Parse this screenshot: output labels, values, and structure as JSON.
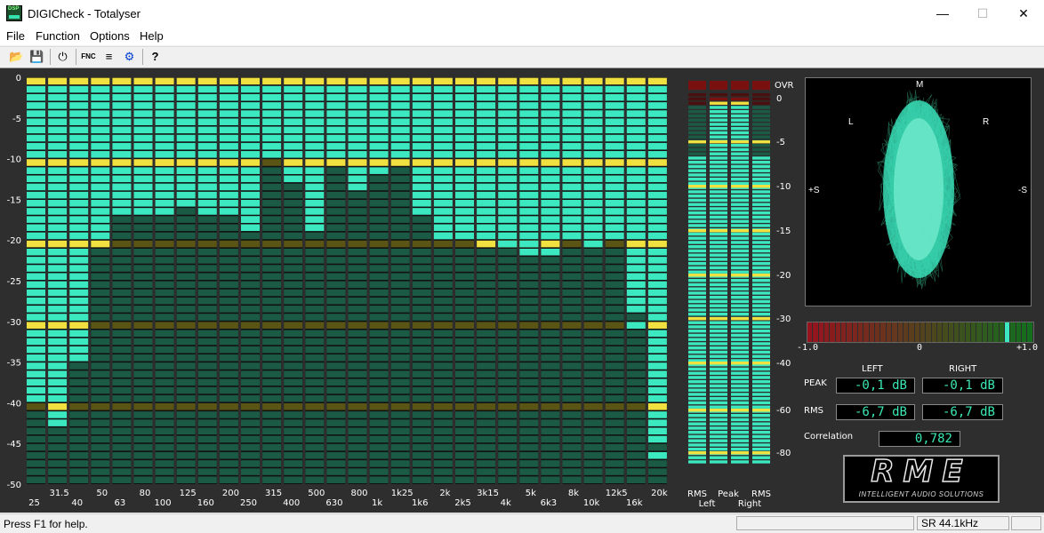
{
  "window": {
    "title": "DIGICheck - Totalyser",
    "icon_label": "DSP",
    "minimize_icon": "minimize-icon",
    "maximize_icon": "maximize-icon",
    "close_icon": "close-icon"
  },
  "menu": [
    "File",
    "Function",
    "Options",
    "Help"
  ],
  "toolbar": {
    "icons": [
      "open-folder-icon",
      "save-icon",
      "power-icon",
      "function-icon",
      "settings-icon",
      "gear-icon",
      "help-icon"
    ],
    "fnc_label": "FNC"
  },
  "colors": {
    "bar_fill": "#3ce8c0",
    "bar_empty": "#1b5a45",
    "marker_yellow": "#f0e040",
    "marker_dim": "#5a5514",
    "panel_bg": "#2e2e2e"
  },
  "chart_data": {
    "type": "bar",
    "title": "",
    "ylabel": "",
    "ylim": [
      -50,
      0
    ],
    "y_ticks": [
      "0",
      "-5",
      "-10",
      "-15",
      "-20",
      "-25",
      "-30",
      "-35",
      "-40",
      "-45",
      "-50"
    ],
    "categories": [
      "25",
      "31.5",
      "40",
      "50",
      "63",
      "80",
      "100",
      "125",
      "160",
      "200",
      "250",
      "315",
      "400",
      "500",
      "630",
      "800",
      "1k",
      "1k25",
      "1k6",
      "2k",
      "2k5",
      "3k15",
      "4k",
      "5k",
      "6k3",
      "8k",
      "10k",
      "12k5",
      "16k",
      "20k"
    ],
    "values": [
      -40.5,
      -43.5,
      -35.5,
      -21.5,
      -17.5,
      -17.5,
      -17.5,
      -16.5,
      -17.5,
      -17.5,
      -19.5,
      -10.5,
      -13.5,
      -19.5,
      -10.5,
      -14.5,
      -12.5,
      -11.5,
      -17.5,
      -20.5,
      -20.5,
      -21.5,
      -21.5,
      -22.5,
      -22.5,
      -20.5,
      -20.5,
      -20.5,
      -29.5,
      -45.5
    ],
    "peaks": [
      null,
      -34,
      -29,
      -18,
      -13,
      -12,
      -10,
      -11,
      -13,
      -9,
      -17,
      -6,
      -11,
      -18,
      -10,
      null,
      null,
      null,
      null,
      -19,
      -14,
      -17,
      -20,
      -20,
      -19,
      -19,
      -20,
      null,
      -30,
      -46
    ]
  },
  "level_meters": {
    "ovr_label": "OVR",
    "scale": [
      "0",
      "-5",
      "-10",
      "-15",
      "-20",
      "-30",
      "-40",
      "-60",
      "-80"
    ],
    "channels": [
      {
        "label_top": "RMS",
        "level": -6.7
      },
      {
        "label_top": "Peak",
        "level": -0.1
      },
      {
        "label_top": "Peak",
        "level": -0.1
      },
      {
        "label_top": "RMS",
        "level": -6.7
      }
    ],
    "label_row1": [
      "RMS",
      "Peak",
      "RMS"
    ],
    "label_row2": [
      "Left",
      "Right"
    ]
  },
  "goniometer": {
    "labels": {
      "m": "M",
      "l": "L",
      "r": "R",
      "plus_s": "+S",
      "minus_s": "-S"
    }
  },
  "correlation_meter": {
    "min_label": "-1.0",
    "mid_label": "0",
    "max_label": "+1.0",
    "value": 0.782
  },
  "readout": {
    "left_label": "LEFT",
    "right_label": "RIGHT",
    "peak_label": "PEAK",
    "rms_label": "RMS",
    "peak_left": "-0,1 dB",
    "peak_right": "-0,1 dB",
    "rms_left": "-6,7 dB",
    "rms_right": "-6,7 dB",
    "correlation_label": "Correlation",
    "correlation_value": "0,782"
  },
  "logo": {
    "text": "RME",
    "subtitle": "INTELLIGENT AUDIO SOLUTIONS"
  },
  "statusbar": {
    "help": "Press F1 for help.",
    "samplerate": "SR 44.1kHz"
  }
}
